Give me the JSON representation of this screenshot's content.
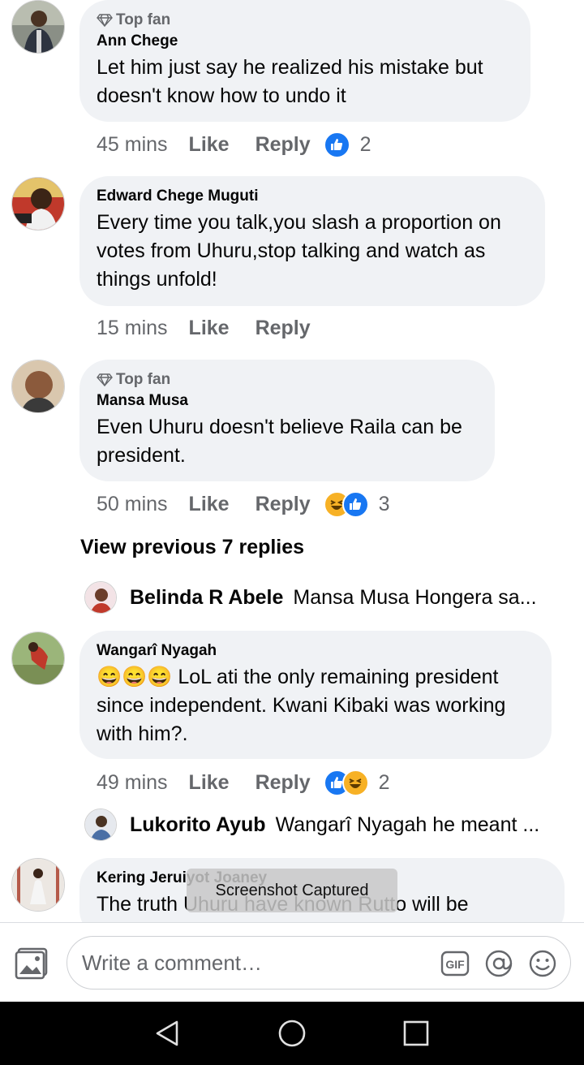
{
  "comments": [
    {
      "top_fan": "Top fan",
      "author": "Ann Chege",
      "text": "Let him just say he realized his mistake but doesn't know how to undo it",
      "time": "45 mins",
      "like": "Like",
      "reply": "Reply",
      "reaction_count": "2",
      "reactions": [
        "like"
      ]
    },
    {
      "author": "Edward Chege Muguti",
      "text": "Every time you talk,you slash a proportion on votes from Uhuru,stop talking and watch as things unfold!",
      "time": "15 mins",
      "like": "Like",
      "reply": "Reply"
    },
    {
      "top_fan": "Top fan",
      "author": "Mansa Musa",
      "text": "Even Uhuru doesn't believe Raila can be president.",
      "time": "50 mins",
      "like": "Like",
      "reply": "Reply",
      "reaction_count": "3",
      "reactions": [
        "haha",
        "like"
      ]
    },
    {
      "author": "Wangarî Nyagah",
      "text": "😄😄😄 LoL ati the only remaining president since independent. Kwani Kibaki was working with him?.",
      "time": "49 mins",
      "like": "Like",
      "reply": "Reply",
      "reaction_count": "2",
      "reactions": [
        "like",
        "haha"
      ]
    },
    {
      "author": "Kering Jeruiyot Joaney",
      "text": "The truth Uhuru have known Rutto will be"
    }
  ],
  "view_previous": "View previous 7 replies",
  "replies": [
    {
      "name": "Belinda R Abele",
      "snippet": "Mansa Musa Hongera sa..."
    },
    {
      "name": "Lukorito Ayub",
      "snippet": "Wangarî Nyagah he meant ..."
    }
  ],
  "toast": "Screenshot Captured",
  "composer": {
    "placeholder": "Write a comment…",
    "icons": [
      "photo-icon",
      "gif-icon",
      "mention-icon",
      "emoji-icon"
    ]
  },
  "navbar": {
    "icons": [
      "back-icon",
      "home-icon",
      "recents-icon"
    ]
  },
  "colors": {
    "bubble": "#f0f2f5",
    "like_blue": "#1877f2",
    "haha_yellow": "#f7b125",
    "meta_gray": "#65676b"
  }
}
